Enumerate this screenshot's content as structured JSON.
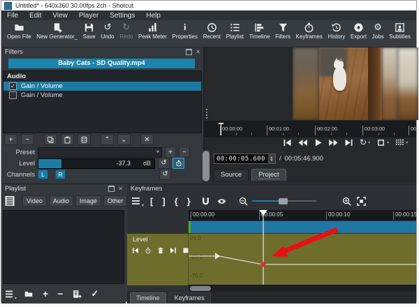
{
  "window": {
    "title": "Untitled* - 640x360 30.00fps 2ch - Shotcut"
  },
  "menu": {
    "items": [
      "File",
      "Edit",
      "View",
      "Player",
      "Settings",
      "Help"
    ]
  },
  "toolbar": {
    "items": [
      {
        "label": "Open File",
        "icon": "open-file-icon"
      },
      {
        "label": "New Generator_",
        "icon": "new-generator-icon"
      },
      {
        "label": "Save",
        "icon": "save-icon"
      },
      {
        "label": "Undo",
        "icon": "undo-icon"
      },
      {
        "label": "Redo",
        "icon": "redo-icon",
        "disabled": true
      },
      {
        "label": "Peak Meter",
        "icon": "peak-meter-icon"
      },
      {
        "label": "Properties",
        "icon": "properties-icon"
      },
      {
        "label": "Recent",
        "icon": "recent-icon"
      },
      {
        "label": "Playlist",
        "icon": "playlist-icon"
      },
      {
        "label": "Timeline",
        "icon": "timeline-icon"
      },
      {
        "label": "Filters",
        "icon": "filters-icon"
      },
      {
        "label": "Keyframes",
        "icon": "keyframes-icon"
      },
      {
        "label": "History",
        "icon": "history-icon"
      },
      {
        "label": "Export",
        "icon": "export-icon"
      },
      {
        "label": "Jobs",
        "icon": "jobs-icon"
      },
      {
        "label": "Subtitles",
        "icon": "subtitles-icon"
      }
    ]
  },
  "icons": {
    "undo_glyph": "↺",
    "redo_glyph": "↻",
    "loop_glyph": "↻",
    "gear_glyph": "⚙",
    "info_glyph": "i",
    "check_glyph": "✓",
    "close_glyph": "✕",
    "caret_down_glyph": "▾",
    "up_glyph": "⌃",
    "down_glyph": "⌄",
    "plus_glyph": "+",
    "minus_glyph": "−",
    "spin_up_glyph": "▲",
    "spin_down_glyph": "▼"
  },
  "filters": {
    "title": "Filters",
    "clip_name": "Baby Cats - SD Quality.mp4",
    "section_label": "Audio",
    "rows": [
      {
        "name": "Gain / Volume",
        "checked": true,
        "selected": true
      },
      {
        "name": "Gain / Volume",
        "checked": false,
        "selected": false
      }
    ],
    "preset_label": "Preset",
    "level_label": "Level",
    "level_value": "-37.3",
    "level_unit": "dB",
    "channels_label": "Channels",
    "channel_l": "L",
    "channel_r": "R"
  },
  "player": {
    "ruler_ticks": [
      "00:00:00",
      "00:01:00",
      "00:02:00",
      "00:03:00",
      "00:0"
    ],
    "position": "00:00:05.600",
    "separator": "/",
    "duration": "00:05:46.900",
    "tabs": [
      {
        "label": "Source"
      },
      {
        "label": "Project",
        "active": true
      }
    ]
  },
  "playlist": {
    "title": "Playlist",
    "filter_buttons": [
      "Video",
      "Audio",
      "Image",
      "Other"
    ]
  },
  "keyframes": {
    "title": "Keyframes",
    "bracket_buttons": [
      "[",
      "]",
      "{",
      "}"
    ],
    "ruler_ticks": [
      "00:00:00",
      "00:00:05",
      "00:00:10",
      "00:00:15"
    ],
    "track": {
      "label": "Level",
      "scale_values": [
        "24.0",
        "-23.0",
        "-70.0"
      ]
    },
    "tabs": [
      {
        "label": "Timeline"
      },
      {
        "label": "Keyframes",
        "active": true
      }
    ]
  },
  "colors": {
    "accent_teal": "#1d84ac",
    "timeline_clip_blue": "#2176a3",
    "clip_start_green": "#52b415",
    "keyframe_graph_olive": "#6e6d2c",
    "annotation_arrow_red": "#e81010",
    "keyframe_point_red": "#e03131"
  }
}
